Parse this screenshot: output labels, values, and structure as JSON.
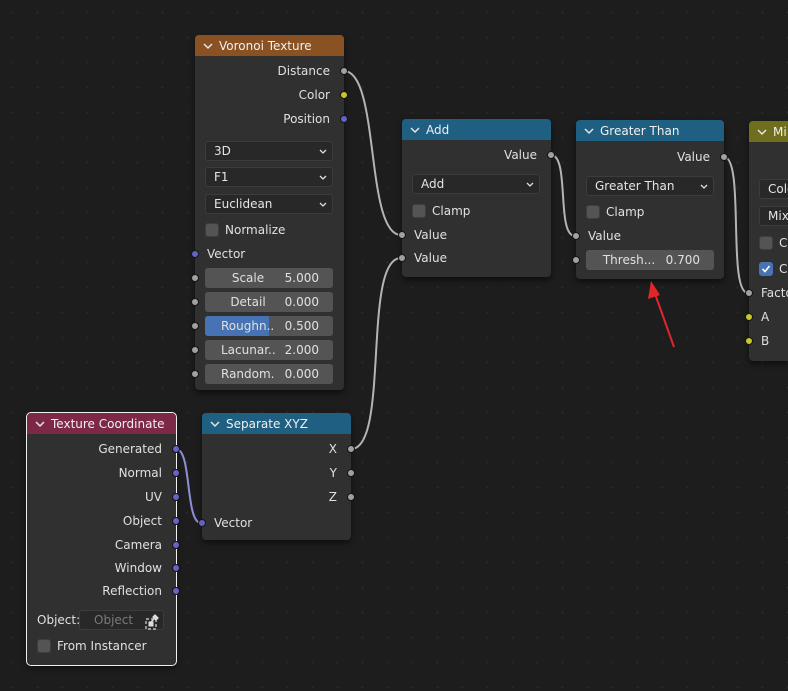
{
  "colors": {
    "texture_header": "#8a5223",
    "converter_header": "#1f5f82",
    "input_header": "#7d2846",
    "mix_header": "#6e6e1c",
    "selection": "#f0f0f0",
    "link": "#b4b4b4",
    "annotation_arrow": "#e0262a"
  },
  "voronoi": {
    "title": "Voronoi Texture",
    "out_distance": "Distance",
    "out_color": "Color",
    "out_position": "Position",
    "dim": "3D",
    "feature": "F1",
    "metric": "Euclidean",
    "normalize": "Normalize",
    "in_vector": "Vector",
    "fields": [
      {
        "label": "Scale",
        "value": "5.000",
        "fill": 0
      },
      {
        "label": "Detail",
        "value": "0.000",
        "fill": 0
      },
      {
        "label": "Roughn...",
        "value": "0.500",
        "fill": 0.5
      },
      {
        "label": "Lacunar...",
        "value": "2.000",
        "fill": 0
      },
      {
        "label": "Random...",
        "value": "0.000",
        "fill": 0
      }
    ]
  },
  "add": {
    "title": "Add",
    "out_value": "Value",
    "operation": "Add",
    "clamp": "Clamp",
    "in_value1": "Value",
    "in_value2": "Value"
  },
  "greater": {
    "title": "Greater Than",
    "out_value": "Value",
    "operation": "Greater Than",
    "clamp": "Clamp",
    "in_value": "Value",
    "threshold_label": "Thresh...",
    "threshold_value": "0.700"
  },
  "mix": {
    "title": "Mi",
    "dd1": "Colo",
    "dd2": "Mix",
    "chk1": "Cl",
    "chk2": "Cl",
    "in_factor": "Facto",
    "in_a": "A",
    "in_b": "B"
  },
  "texcoord": {
    "title": "Texture Coordinate",
    "outputs": [
      "Generated",
      "Normal",
      "UV",
      "Object",
      "Camera",
      "Window",
      "Reflection"
    ],
    "object_label": "Object:",
    "object_placeholder": "Object",
    "from_instancer": "From Instancer"
  },
  "sepxyz": {
    "title": "Separate XYZ",
    "out_x": "X",
    "out_y": "Y",
    "out_z": "Z",
    "in_vector": "Vector"
  }
}
